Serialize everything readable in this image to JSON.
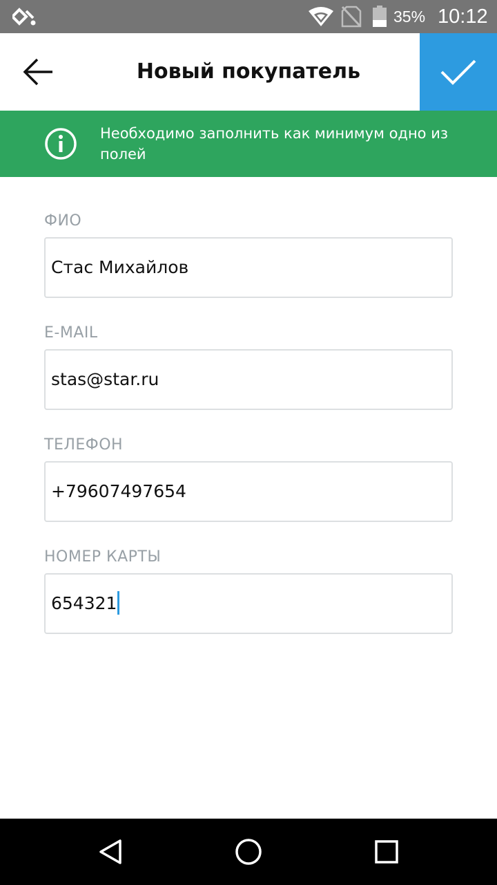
{
  "status_bar": {
    "battery_percent": "35%",
    "time": "10:12",
    "icons": [
      "app-logo-icon",
      "wifi-icon",
      "no-sim-icon",
      "battery-icon"
    ]
  },
  "header": {
    "title": "Новый покупатель",
    "back_icon": "arrow-left-icon",
    "confirm_icon": "checkmark-icon"
  },
  "banner": {
    "icon": "info-icon",
    "message": "Необходимо заполнить как минимум одно из полей"
  },
  "form": {
    "fields": [
      {
        "label": "ФИО",
        "value": "Стас Михайлов"
      },
      {
        "label": "E-MAIL",
        "value": "stas@star.ru"
      },
      {
        "label": "ТЕЛЕФОН",
        "value": "+79607497654"
      },
      {
        "label": "НОМЕР КАРТЫ",
        "value": "654321",
        "focused": true
      }
    ]
  },
  "colors": {
    "accent": "#2d9be0",
    "banner": "#2ea55e",
    "status_bar": "#757575",
    "label": "#98a0a6"
  },
  "nav_bar": {
    "icons": [
      "back-triangle-icon",
      "home-circle-icon",
      "recents-square-icon"
    ]
  }
}
